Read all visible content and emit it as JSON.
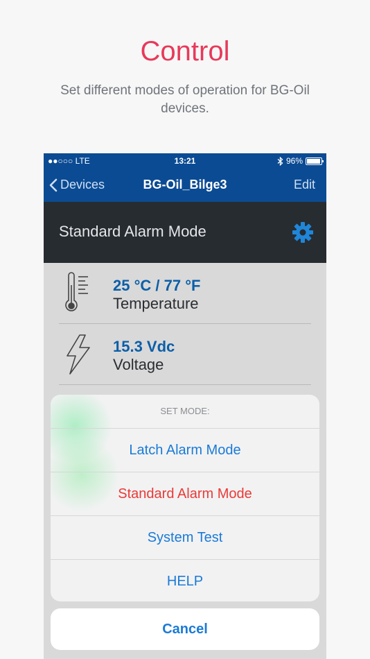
{
  "promo": {
    "title": "Control",
    "subtitle": "Set different modes of operation for BG-Oil devices."
  },
  "status_bar": {
    "carrier": "●●○○○ LTE",
    "time": "13:21",
    "bluetooth_icon": "bluetooth-icon",
    "battery": "96%",
    "battery_level": 0.96
  },
  "nav": {
    "back_label": "Devices",
    "title": "BG-Oil_Bilge3",
    "edit_label": "Edit"
  },
  "mode": {
    "label": "Standard Alarm Mode",
    "settings_icon": "gear-icon"
  },
  "readings": [
    {
      "value": "25 °C / 77 °F",
      "name": "Temperature",
      "icon": "thermometer-icon"
    },
    {
      "value": "15.3 Vdc",
      "name": "Voltage",
      "icon": "lightning-icon"
    }
  ],
  "action_sheet": {
    "header": "SET MODE:",
    "options": [
      {
        "label": "Latch Alarm Mode"
      },
      {
        "label": "Standard Alarm Mode"
      },
      {
        "label": "System Test"
      },
      {
        "label": "HELP"
      }
    ],
    "cancel_label": "Cancel"
  },
  "colors": {
    "accent_red": "#e8395a",
    "nav_blue": "#0b4b93",
    "link_blue": "#1a7ad6",
    "destructive_red": "#ea3a36"
  }
}
